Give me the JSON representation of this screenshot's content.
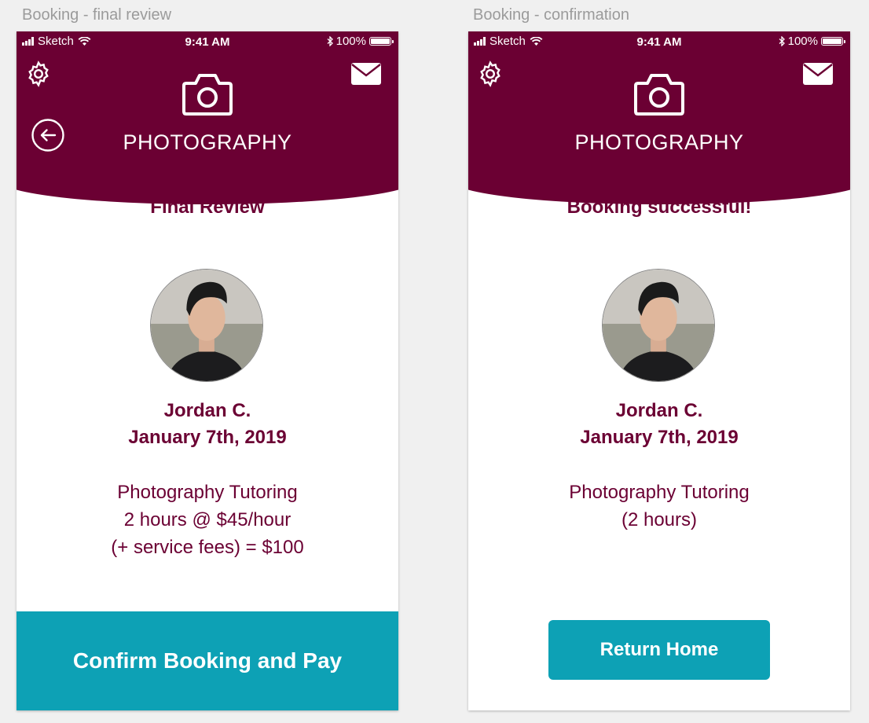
{
  "screens": [
    {
      "artboard_label": "Booking - final review",
      "status": {
        "carrier": "Sketch",
        "time": "9:41 AM",
        "battery": "100%"
      },
      "brand": "PHOTOGRAPHY",
      "title": "Final Review",
      "tutor_name": "Jordan C.",
      "date": "January 7th, 2019",
      "service": "Photography Tutoring",
      "line2": "2 hours @ $45/hour",
      "line3": "(+ service fees) = $100",
      "cta_label": "Confirm Booking and Pay"
    },
    {
      "artboard_label": "Booking - confirmation",
      "status": {
        "carrier": "Sketch",
        "time": "9:41 AM",
        "battery": "100%"
      },
      "brand": "PHOTOGRAPHY",
      "title": "Booking successful!",
      "tutor_name": "Jordan C.",
      "date": "January 7th, 2019",
      "service": "Photography Tutoring",
      "line2": "(2 hours)",
      "cta_label": "Return Home"
    }
  ],
  "icons": {
    "settings": "gear-icon",
    "messages": "mail-icon",
    "back": "back-arrow-icon",
    "logo": "camera-icon"
  },
  "colors": {
    "brand": "#6b0033",
    "accent": "#0da1b5",
    "background": "#f0f0f0"
  }
}
